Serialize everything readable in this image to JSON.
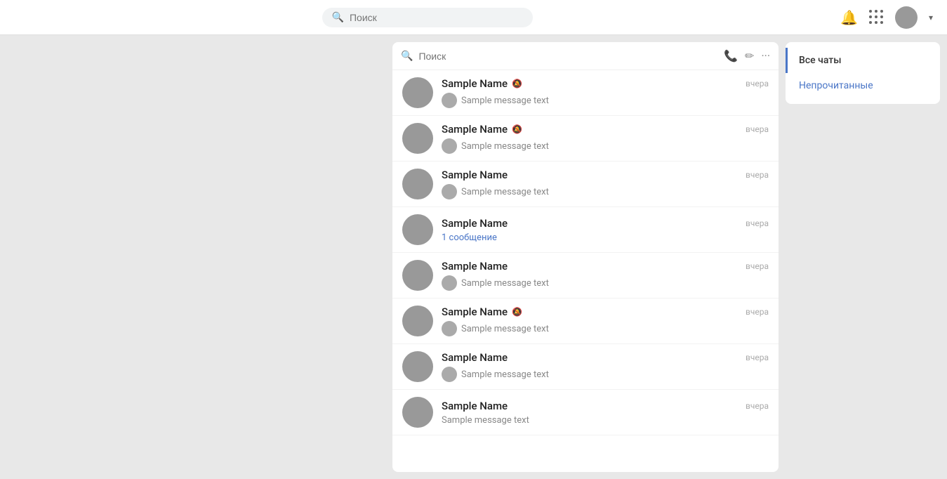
{
  "header": {
    "search_placeholder": "Поиск",
    "user_chevron": "▾"
  },
  "chat_panel": {
    "search_placeholder": "Поиск",
    "toolbar": {
      "phone_label": "📞",
      "edit_label": "✏",
      "more_label": "···"
    }
  },
  "filter_panel": {
    "items": [
      {
        "label": "Все чаты",
        "active": true
      },
      {
        "label": "Непрочитанные",
        "active": false
      }
    ]
  },
  "chats": [
    {
      "name": "Sample Name",
      "time": "вчера",
      "message": "Sample message text",
      "muted": true,
      "has_avatar_in_message": true,
      "unread": null
    },
    {
      "name": "Sample Name",
      "time": "вчера",
      "message": "Sample message text",
      "muted": true,
      "has_avatar_in_message": true,
      "unread": null
    },
    {
      "name": "Sample Name",
      "time": "вчера",
      "message": "Sample message text",
      "muted": false,
      "has_avatar_in_message": true,
      "unread": null
    },
    {
      "name": "Sample Name",
      "time": "вчера",
      "message": null,
      "muted": false,
      "has_avatar_in_message": false,
      "unread": "1 сообщение"
    },
    {
      "name": "Sample Name",
      "time": "вчера",
      "message": "Sample message text",
      "muted": false,
      "has_avatar_in_message": true,
      "unread": null
    },
    {
      "name": "Sample Name",
      "time": "вчера",
      "message": "Sample message text",
      "muted": true,
      "has_avatar_in_message": true,
      "unread": null
    },
    {
      "name": "Sample Name",
      "time": "вчера",
      "message": "Sample message text",
      "muted": false,
      "has_avatar_in_message": true,
      "unread": null
    },
    {
      "name": "Sample Name",
      "time": "вчера",
      "message": "Sample message text",
      "muted": false,
      "has_avatar_in_message": false,
      "unread": null
    }
  ]
}
